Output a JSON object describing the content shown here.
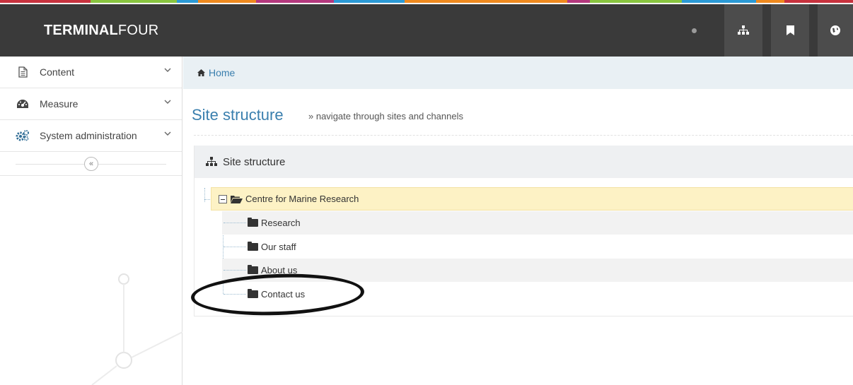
{
  "brand": {
    "bold": "TERMINAL",
    "light": "FOUR"
  },
  "colors": {
    "strip": [
      "#c8323e",
      "#89c540",
      "#2b9ad6",
      "#ef8a1f",
      "#b5387e",
      "#2b9ad6",
      "#ef8a1f",
      "#b5387e",
      "#89c540",
      "#2b9ad6",
      "#ef8a1f",
      "#c8323e"
    ],
    "accent": "#3a7fae",
    "topbar": "#3a3a3a",
    "highlight": "#fdf2c5"
  },
  "topbar": {
    "icons": [
      "status-dot-icon",
      "sitemap-icon",
      "bookmark-icon",
      "globe-icon"
    ]
  },
  "sidebar": {
    "items": [
      {
        "label": "Content",
        "icon": "document-icon"
      },
      {
        "label": "Measure",
        "icon": "dashboard-icon"
      },
      {
        "label": "System administration",
        "icon": "gears-icon"
      }
    ],
    "collapse_label": "«"
  },
  "breadcrumb": {
    "home": "Home"
  },
  "page": {
    "title": "Site structure",
    "subtitle": "» navigate through sites and channels"
  },
  "panel": {
    "title": "Site structure",
    "tree": {
      "root": "Centre for Marine Research",
      "children": [
        "Research",
        "Our staff",
        "About us",
        "Contact us"
      ]
    }
  }
}
